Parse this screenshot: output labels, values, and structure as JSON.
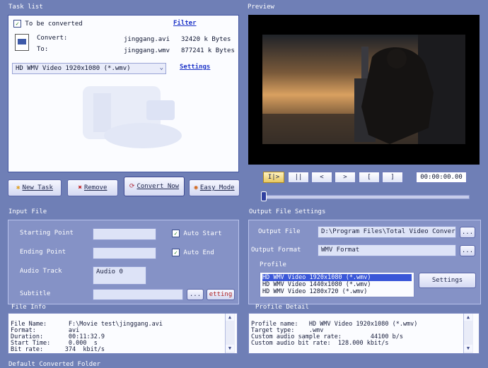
{
  "task_list": {
    "title": "Task list",
    "checkbox_label": "To be converted",
    "filter_link": "Filter",
    "convert_label": "Convert:",
    "to_label": "To:",
    "source_file": "jinggang.avi",
    "source_size": "32420 k Bytes",
    "target_file": "jinggang.wmv",
    "target_size": "877241 k Bytes",
    "format_select": "HD WMV Video 1920x1080 (*.wmv)",
    "settings_link": "Settings"
  },
  "buttons": {
    "new_task": "New Task",
    "remove": "Remove",
    "convert_now": "Convert Now",
    "easy_mode": "Easy Mode"
  },
  "preview": {
    "title": "Preview",
    "controls": [
      "I|>",
      "||",
      "<",
      ">",
      "[",
      "]"
    ],
    "time": "00:00:00.00",
    "progress": 0.0
  },
  "input_file": {
    "title": "Input File",
    "starting_point_label": "Starting Point",
    "ending_point_label": "Ending Point",
    "auto_start": "Auto Start",
    "auto_end": "Auto End",
    "audio_track_label": "Audio Track",
    "audio_track_value": "Audio 0",
    "subtitle_label": "Subtitle",
    "browse": "...",
    "subtitle_setting": "etting"
  },
  "file_info": {
    "title": "File Info",
    "lines": [
      "File Name:      F:\\Movie test\\jinggang.avi",
      "Format:         avi",
      "Duration:       00:11:32.9",
      "Start Time:     0.000  s",
      "Bit rate:      374  kbit/s"
    ]
  },
  "output": {
    "title": "Output File Settings",
    "output_file_label": "Output File",
    "output_file_value": "D:\\Program Files\\Total Video Convert",
    "output_format_label": "Output Format",
    "output_format_value": "WMV Format",
    "browse": "...",
    "profile_label": "Profile",
    "profiles": [
      "HD WMV Video 1920x1080 (*.wmv)",
      "HD WMV Video 1440x1080 (*.wmv)",
      "HD WMV Video 1280x720 (*.wmv)"
    ],
    "selected_profile": 0,
    "settings_button": "Settings",
    "profile_detail_label": "Profile Detail",
    "detail_lines": [
      "Profile name:   HD WMV Video 1920x1080 (*.wmv)",
      "Target type:    .wmv",
      "",
      "Custom audio sample rate:        44100 b/s",
      "Custom audio bit rate:  128.000 kbit/s"
    ]
  },
  "bottom_cut_label": "Default Converted Folder"
}
